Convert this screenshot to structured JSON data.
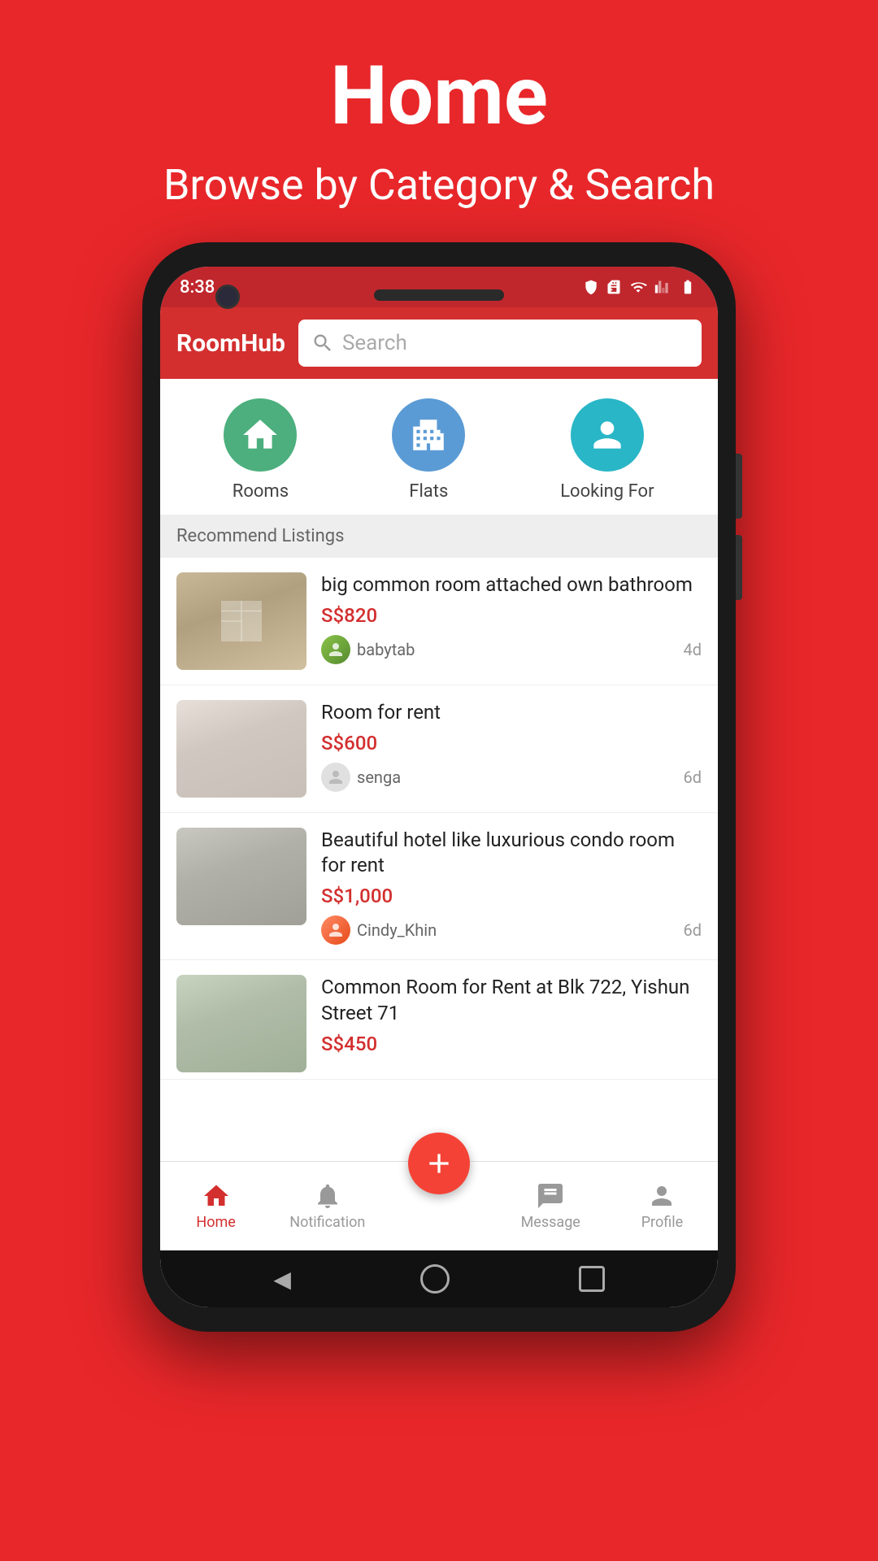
{
  "banner": {
    "title": "Home",
    "subtitle": "Browse by Category & Search"
  },
  "status_bar": {
    "time": "8:38"
  },
  "app_bar": {
    "logo": "RoomHub",
    "search_placeholder": "Search"
  },
  "categories": [
    {
      "id": "rooms",
      "label": "Rooms",
      "color": "green",
      "icon": "house"
    },
    {
      "id": "flats",
      "label": "Flats",
      "color": "blue",
      "icon": "building"
    },
    {
      "id": "looking",
      "label": "Looking For",
      "color": "teal",
      "icon": "person"
    }
  ],
  "section_header": "Recommend Listings",
  "listings": [
    {
      "title": "big common room attached own bathroom",
      "price": "S$820",
      "user": "babytab",
      "time": "4d",
      "avatar_type": "has-photo-1",
      "img_class": "img-1"
    },
    {
      "title": "Room for rent",
      "price": "S$600",
      "user": "senga",
      "time": "6d",
      "avatar_type": "has-photo-2",
      "img_class": "img-2"
    },
    {
      "title": "Beautiful hotel like luxurious condo room for rent",
      "price": "S$1,000",
      "user": "Cindy_Khin",
      "time": "6d",
      "avatar_type": "has-photo-3",
      "img_class": "img-3"
    },
    {
      "title": "Common Room for Rent at Blk 722, Yishun Street 71",
      "price": "S$450",
      "user": "",
      "time": "",
      "avatar_type": "has-photo-2",
      "img_class": "img-4"
    }
  ],
  "bottom_nav": [
    {
      "id": "home",
      "label": "Home",
      "active": true
    },
    {
      "id": "notification",
      "label": "Notification",
      "active": false
    },
    {
      "id": "post",
      "label": "Post",
      "active": false
    },
    {
      "id": "message",
      "label": "Message",
      "active": false
    },
    {
      "id": "profile",
      "label": "Profile",
      "active": false
    }
  ]
}
